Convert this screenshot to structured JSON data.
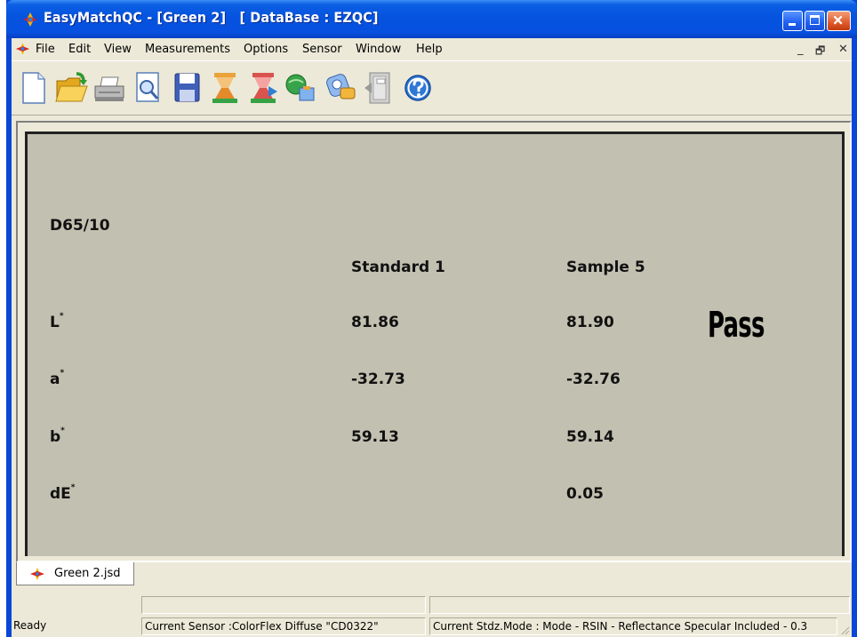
{
  "window": {
    "title": "EasyMatchQC - [Green 2]   [ DataBase : EZQC]"
  },
  "menu": {
    "items": [
      "File",
      "Edit",
      "View",
      "Measurements",
      "Options",
      "Sensor",
      "Window",
      "Help"
    ],
    "mdi_min": "_",
    "mdi_restore": "🗗",
    "mdi_close": "✕"
  },
  "toolbar": {
    "icons": [
      "new-file-icon",
      "open-folder-icon",
      "print-icon",
      "print-preview-icon",
      "save-icon",
      "read-standard-icon",
      "read-sample-icon",
      "standardize-icon",
      "sensor-setup-icon",
      "exit-icon",
      "help-icon"
    ]
  },
  "report": {
    "illuminant": "D65/10",
    "col_standard": "Standard 1",
    "col_sample": "Sample 5",
    "rows": [
      {
        "label": "L",
        "sup": "*",
        "standard": "81.86",
        "sample": "81.90"
      },
      {
        "label": "a",
        "sup": "*",
        "standard": "-32.73",
        "sample": "-32.76"
      },
      {
        "label": "b",
        "sup": "*",
        "standard": "59.13",
        "sample": "59.14"
      },
      {
        "label": "dE",
        "sup": "*",
        "standard": "",
        "sample": "0.05"
      }
    ],
    "result": "Pass"
  },
  "tab": {
    "label": "Green 2.jsd"
  },
  "status": {
    "ready": "Ready",
    "sensor": "Current Sensor :ColorFlex Diffuse \"CD0322\"",
    "mode": "Current Stdz.Mode :  Mode - RSIN - Reflectance Specular Included - 0.3"
  },
  "colors": {
    "titlebar": "#0553df",
    "document_bg": "#c2c0b0",
    "chrome": "#ece9d8"
  }
}
